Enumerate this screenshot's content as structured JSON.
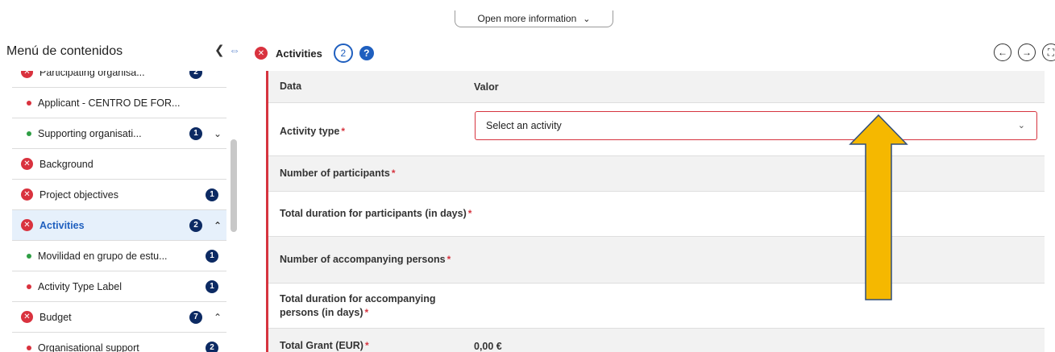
{
  "top_toggle": {
    "label": "Open more information"
  },
  "sidebar": {
    "title": "Menú de contenidos",
    "items": [
      {
        "label": "Participating organisa...",
        "badge": "2",
        "kind": "section"
      },
      {
        "label": "Applicant - CENTRO DE FOR...",
        "kind": "sub",
        "dot": "red"
      },
      {
        "label": "Supporting organisati...",
        "badge": "1",
        "kind": "sub",
        "dot": "green"
      },
      {
        "label": "Background",
        "kind": "section"
      },
      {
        "label": "Project objectives",
        "badge": "1",
        "kind": "section"
      },
      {
        "label": "Activities",
        "badge": "2",
        "kind": "section",
        "active": true
      },
      {
        "label": "Movilidad en grupo de estu...",
        "badge": "1",
        "kind": "sub",
        "dot": "green"
      },
      {
        "label": "Activity Type Label",
        "badge": "1",
        "kind": "sub",
        "dot": "red"
      },
      {
        "label": "Budget",
        "badge": "7",
        "kind": "section"
      },
      {
        "label": "Organisational support",
        "badge": "2",
        "kind": "sub",
        "dot": "red"
      }
    ]
  },
  "main": {
    "title": "Activities",
    "count": "2",
    "help": "?"
  },
  "table": {
    "header": {
      "label": "Data",
      "value": "Valor"
    },
    "activity_type": {
      "label": "Activity type",
      "placeholder": "Select an activity"
    },
    "rows": [
      {
        "label": "Number of participants"
      },
      {
        "label": "Total duration for participants (in days)"
      },
      {
        "label": "Number of accompanying persons"
      },
      {
        "label": "Total duration for accompanying persons (in days)"
      },
      {
        "label": "Total Grant (EUR)",
        "value": "0,00 €"
      }
    ],
    "required_mark": "*"
  },
  "colors": {
    "accent": "#1f5fbf",
    "error": "#d6343f",
    "annotation_arrow": "#f5b800",
    "badge": "#0c2a63"
  },
  "icons": {
    "error": "x-circle-icon",
    "help": "question-icon",
    "collapse": "chevron-left-icon",
    "resize": "double-arrow-icon",
    "prev": "arrow-left-icon",
    "next": "arrow-right-icon",
    "expand": "fullscreen-icon"
  }
}
